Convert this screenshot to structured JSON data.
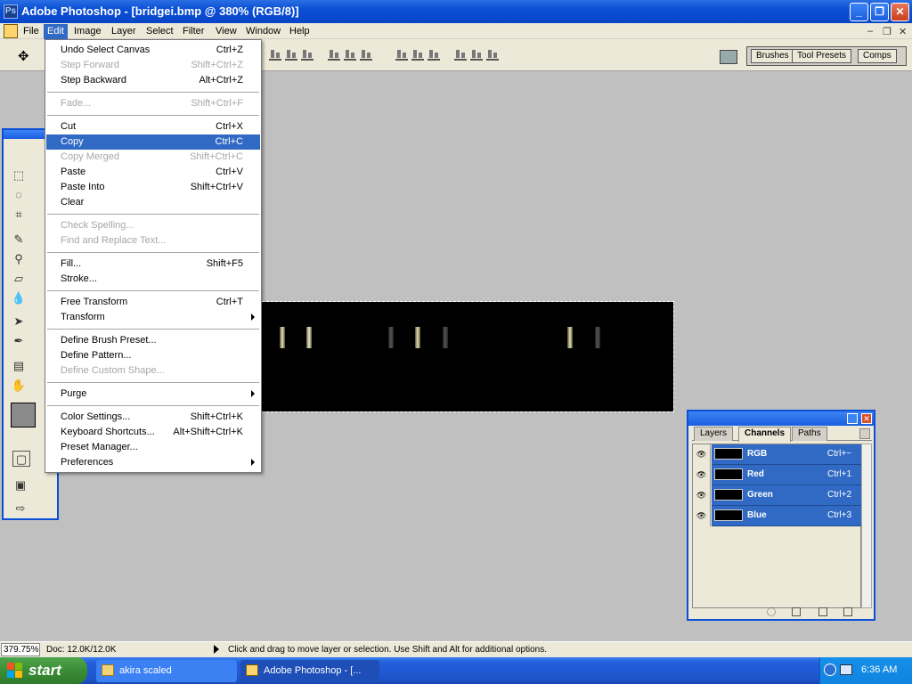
{
  "window": {
    "title": "Adobe Photoshop - [bridgei.bmp @ 380% (RGB/8)]",
    "min_glyph": "_",
    "max_glyph": "❐",
    "close_glyph": "✕"
  },
  "menubar": {
    "items": [
      "File",
      "Edit",
      "Image",
      "Layer",
      "Select",
      "Filter",
      "View",
      "Window",
      "Help"
    ],
    "active": "Edit",
    "doc_min_glyph": "–",
    "doc_restore_glyph": "❐",
    "doc_close_glyph": "✕"
  },
  "options_bar": {
    "palette_well_tabs": [
      "Brushes",
      "Tool Presets",
      "Comps"
    ]
  },
  "edit_menu": {
    "items": [
      {
        "label": "Undo Select Canvas",
        "shortcut": "Ctrl+Z",
        "enabled": true
      },
      {
        "label": "Step Forward",
        "shortcut": "Shift+Ctrl+Z",
        "enabled": false
      },
      {
        "label": "Step Backward",
        "shortcut": "Alt+Ctrl+Z",
        "enabled": true
      },
      {
        "label": "Fade...",
        "shortcut": "Shift+Ctrl+F",
        "enabled": false
      },
      {
        "label": "Cut",
        "shortcut": "Ctrl+X",
        "enabled": true
      },
      {
        "label": "Copy",
        "shortcut": "Ctrl+C",
        "enabled": true,
        "selected": true
      },
      {
        "label": "Copy Merged",
        "shortcut": "Shift+Ctrl+C",
        "enabled": false
      },
      {
        "label": "Paste",
        "shortcut": "Ctrl+V",
        "enabled": true
      },
      {
        "label": "Paste Into",
        "shortcut": "Shift+Ctrl+V",
        "enabled": true
      },
      {
        "label": "Clear",
        "shortcut": "",
        "enabled": true
      },
      {
        "label": "Check Spelling...",
        "shortcut": "",
        "enabled": false
      },
      {
        "label": "Find and Replace Text...",
        "shortcut": "",
        "enabled": false
      },
      {
        "label": "Fill...",
        "shortcut": "Shift+F5",
        "enabled": true
      },
      {
        "label": "Stroke...",
        "shortcut": "",
        "enabled": true
      },
      {
        "label": "Free Transform",
        "shortcut": "Ctrl+T",
        "enabled": true
      },
      {
        "label": "Transform",
        "shortcut": "",
        "enabled": true,
        "submenu": true
      },
      {
        "label": "Define Brush Preset...",
        "shortcut": "",
        "enabled": true
      },
      {
        "label": "Define Pattern...",
        "shortcut": "",
        "enabled": true
      },
      {
        "label": "Define Custom Shape...",
        "shortcut": "",
        "enabled": false
      },
      {
        "label": "Purge",
        "shortcut": "",
        "enabled": true,
        "submenu": true
      },
      {
        "label": "Color Settings...",
        "shortcut": "Shift+Ctrl+K",
        "enabled": true
      },
      {
        "label": "Keyboard Shortcuts...",
        "shortcut": "Alt+Shift+Ctrl+K",
        "enabled": true
      },
      {
        "label": "Preset Manager...",
        "shortcut": "",
        "enabled": true
      },
      {
        "label": "Preferences",
        "shortcut": "",
        "enabled": true,
        "submenu": true
      }
    ]
  },
  "channels_panel": {
    "tabs": [
      "Layers",
      "Channels",
      "Paths"
    ],
    "active_tab": "Channels",
    "channels": [
      {
        "name": "RGB",
        "shortcut": "Ctrl+~"
      },
      {
        "name": "Red",
        "shortcut": "Ctrl+1"
      },
      {
        "name": "Green",
        "shortcut": "Ctrl+2"
      },
      {
        "name": "Blue",
        "shortcut": "Ctrl+3"
      }
    ]
  },
  "statusbar": {
    "zoom": "379.75%",
    "doc": "Doc: 12.0K/12.0K",
    "message": "Click and drag to move layer or selection.  Use Shift and Alt for additional options."
  },
  "taskbar": {
    "start_label": "start",
    "tasks": [
      "akira scaled",
      "Adobe Photoshop - [..."
    ],
    "clock": "6:36 AM"
  },
  "colors": {
    "selection_blue": "#316ac5",
    "xp_blue": "#0a4fd6",
    "menu_bg": "#ece9d8",
    "workspace": "#c0c0c0"
  }
}
